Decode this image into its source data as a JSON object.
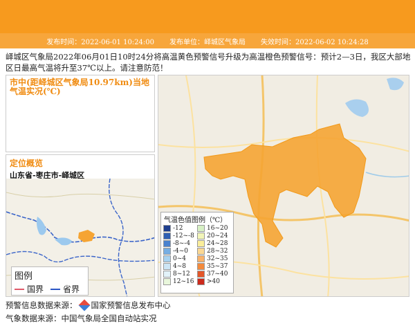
{
  "header": {
    "publish_time": "发布时间：2022-06-01 10:24:00",
    "publisher": "发布单位：峄城区气象局",
    "expire_time": "失效时间：2022-06-02 10:24:28"
  },
  "notice": "峄城区气象局2022年06月01日10时24分将高温黄色预警信号升级为高温橙色预警信号：预计2—3日，我区大部地区日最高气温将升至37℃以上。请注意防范！",
  "panel_temp": {
    "title": "市中(距峄城区气象局10.97km)当地气温实况(℃)"
  },
  "panel_loc": {
    "title": "定位概览",
    "location": "山东省-枣庄市-峄城区",
    "legend_title": "图例",
    "legend_country": "国界",
    "legend_province": "省界"
  },
  "temp_legend": {
    "title": "气温色值图例（℃）",
    "items": [
      {
        "label": "-12",
        "color": "#1e3f8f"
      },
      {
        "label": "16~20",
        "color": "#d7f1c4"
      },
      {
        "label": "-12~-8",
        "color": "#2f5fb3"
      },
      {
        "label": "20~24",
        "color": "#f2f5b8"
      },
      {
        "label": "-8~-4",
        "color": "#4a82cf"
      },
      {
        "label": "24~28",
        "color": "#fbee9a"
      },
      {
        "label": "-4~0",
        "color": "#77aee3"
      },
      {
        "label": "28~32",
        "color": "#fbd893"
      },
      {
        "label": "0~4",
        "color": "#a8d2f0"
      },
      {
        "label": "32~35",
        "color": "#f9b26a"
      },
      {
        "label": "4~8",
        "color": "#cde6f6"
      },
      {
        "label": "35~37",
        "color": "#f48a3c"
      },
      {
        "label": "8~12",
        "color": "#e2f2f9"
      },
      {
        "label": "37~40",
        "color": "#e4572a"
      },
      {
        "label": "12~16",
        "color": "#e9f7dc"
      },
      {
        "label": ">40",
        "color": "#cc2a1c"
      }
    ]
  },
  "sources": {
    "warning": "预警信息数据来源：",
    "warning_org": "国家预警信息发布中心",
    "weather": "气象数据来源：中国气象局全国自动站实况"
  },
  "colors": {
    "accent": "#f79a1e",
    "warning_area": "#f5a433",
    "country_border": "#e05a6a",
    "province_border": "#2a56c6"
  }
}
